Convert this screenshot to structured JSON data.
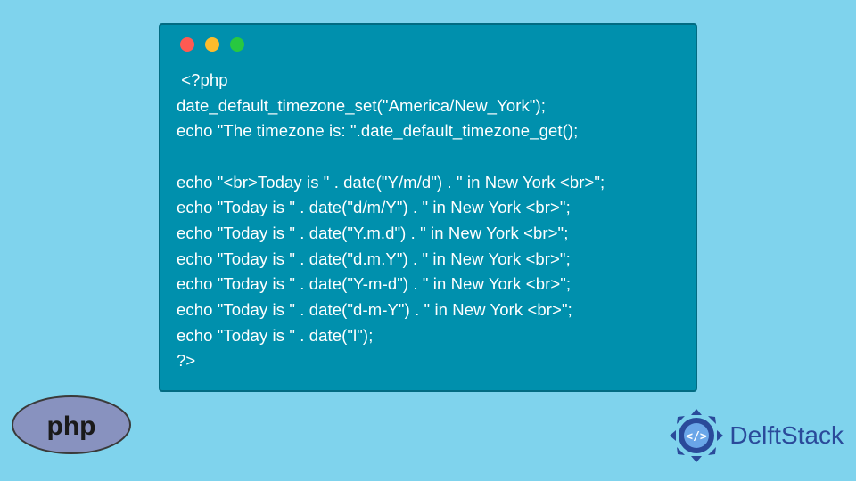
{
  "code": {
    "l1": " <?php",
    "l2": "date_default_timezone_set(\"America/New_York\");",
    "l3": "echo \"The timezone is: \".date_default_timezone_get();",
    "l4": "",
    "l5": "echo \"<br>Today is \" . date(\"Y/m/d\") . \" in New York <br>\";",
    "l6": "echo \"Today is \" . date(\"d/m/Y\") . \" in New York <br>\";",
    "l7": "echo \"Today is \" . date(\"Y.m.d\") . \" in New York <br>\";",
    "l8": "echo \"Today is \" . date(\"d.m.Y\") . \" in New York <br>\";",
    "l9": "echo \"Today is \" . date(\"Y-m-d\") . \" in New York <br>\";",
    "l10": "echo \"Today is \" . date(\"d-m-Y\") . \" in New York <br>\";",
    "l11": "echo \"Today is \" . date(\"l\");",
    "l12": "?>"
  },
  "brand": {
    "php": "php",
    "delftstack": "DelftStack"
  }
}
